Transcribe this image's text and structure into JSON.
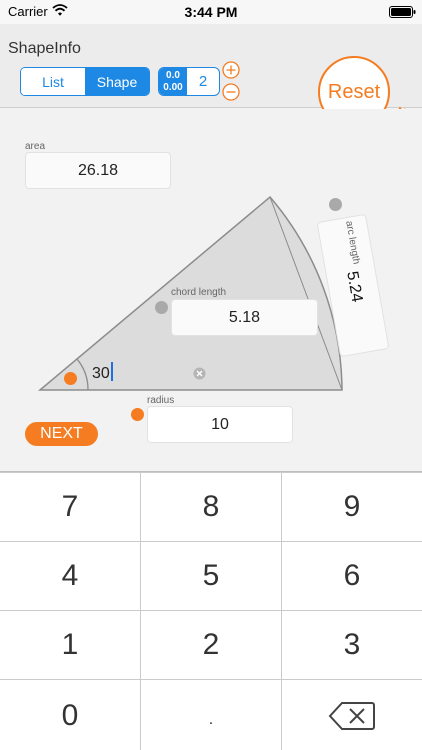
{
  "status_bar": {
    "carrier": "Carrier",
    "time": "3:44 PM"
  },
  "header": {
    "title": "ShapeInfo",
    "segments": [
      {
        "label": "List",
        "selected": false
      },
      {
        "label": "Shape",
        "selected": true
      }
    ],
    "decimal_badge_top": "0.0",
    "decimal_badge_bottom": "0.00",
    "decimal_places": "2",
    "reset_label": "Reset"
  },
  "shape": {
    "area_label": "area",
    "area_value": "26.18",
    "arc_length_label": "arc length",
    "arc_length_value": "5.24",
    "chord_length_label": "chord length",
    "chord_length_value": "5.18",
    "angle_value": "30",
    "radius_label": "radius",
    "radius_value": "10"
  },
  "next_label": "NEXT",
  "keypad": {
    "keys": [
      "7",
      "8",
      "9",
      "4",
      "5",
      "6",
      "1",
      "2",
      "3",
      "0",
      "."
    ]
  },
  "colors": {
    "accent_blue": "#1e88e5",
    "accent_orange": "#f57c20",
    "shape_fill": "#dcdcdc",
    "shape_stroke": "#8c8c8c"
  }
}
